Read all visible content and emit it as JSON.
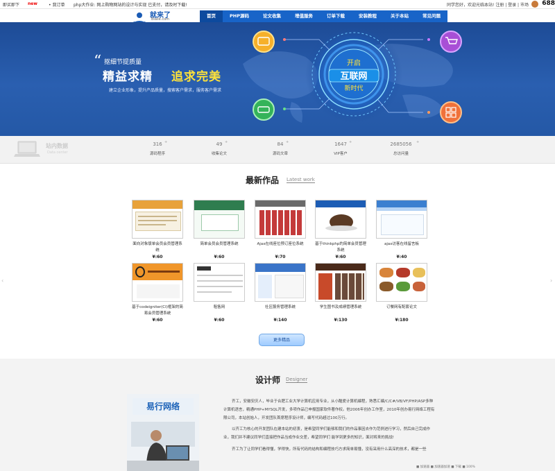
{
  "topbar": {
    "item1": "即买即下",
    "new_label": "new",
    "item2": "• 我订单",
    "ticker": "php大作业: 网上购物网站的设计与实现 已支付，请及时下载!",
    "right_text": "同学您好，欢迎光临本站! 注册 | 登录 | 市场",
    "count": "688"
  },
  "logo": {
    "name": "就来了",
    "domain": "Blaile.com"
  },
  "nav": {
    "items": [
      "首页",
      "PHP源码",
      "论文收集",
      "增值服务",
      "订单下载",
      "安装教程",
      "关于本站",
      "常见问题"
    ]
  },
  "hero": {
    "tagline": "抠细节提质量",
    "slogan1": "精益求精",
    "slogan2": "追求完美",
    "sub": "建立企业形象，提升产品质量，搜索客户需求，服务客户需求",
    "center_line1": "开启",
    "center_line2": "互联网",
    "center_line3": "新时代"
  },
  "stats": {
    "station_title": "站内数据",
    "station_en": "Data center",
    "items": [
      {
        "num": "316",
        "label": "源码程序"
      },
      {
        "num": "49",
        "label": "收集论文"
      },
      {
        "num": "84",
        "label": "源码文章"
      },
      {
        "num": "1647",
        "label": "VIP客户"
      },
      {
        "num": "2685056",
        "label": "总访问量"
      }
    ]
  },
  "works": {
    "title": "最新作品",
    "title_en": "Latest work",
    "items": [
      {
        "caption": "面向对象版单会员会员管理系统",
        "price": "¥:60"
      },
      {
        "caption": "简单会员会员管理系统",
        "price": "¥:60"
      },
      {
        "caption": "Ajax在线座位预订座位系统",
        "price": "¥:70"
      },
      {
        "caption": "基于thinkphp的简单会员管理系统",
        "price": "¥:60"
      },
      {
        "caption": "ajax访客在线留言板",
        "price": "¥:40"
      },
      {
        "caption": "基于codeigniter(CI)框架的简易会员管理系统",
        "price": "¥:60"
      },
      {
        "caption": "租售网",
        "price": "¥:60"
      },
      {
        "caption": "社区服务管理系统",
        "price": "¥:140"
      },
      {
        "caption": "学生图书及成绩管理系统",
        "price": "¥:130"
      },
      {
        "caption": "订餐网有配套论文",
        "price": "¥:180"
      }
    ],
    "more_label": "更多精品"
  },
  "designer": {
    "title": "设计师",
    "title_en": "Designer",
    "photo_sign": "易行网络",
    "para1": "齐工，安徽安庆人，毕业于合肥工业大学计算机应用专业，从小酷爱计算机编程，熟悉汇编/C/C#/VB/VF/PHP/ASP多种计算机语言，精通PHP+MYSQL开发，多项作品已申报国家软件著作权。他2006年创办工作室，2010年创办易行网络工程有限公司，本站创始人，开发团队首席程序设计师，编写代码超过100万行。",
    "para2": "以齐工为核心的开发团队在建本站的初衷，是希望同学们能够和我们的作品事因去作为范例进行学习，然后自己完成作业，我们并不建议同学们直接把作品当成作业交差，希望同学们 能学到更多的知识，面对将来的挑战!",
    "para3": "齐工为了让同学们看得懂，学得快，所有代码的结构和编程技巧方求简单易懂，没有采用什么高深的技术，都是一些"
  },
  "statusbar": "■ 加速器    ■ 加速器加速    ■ 下载    ■ 100%"
}
